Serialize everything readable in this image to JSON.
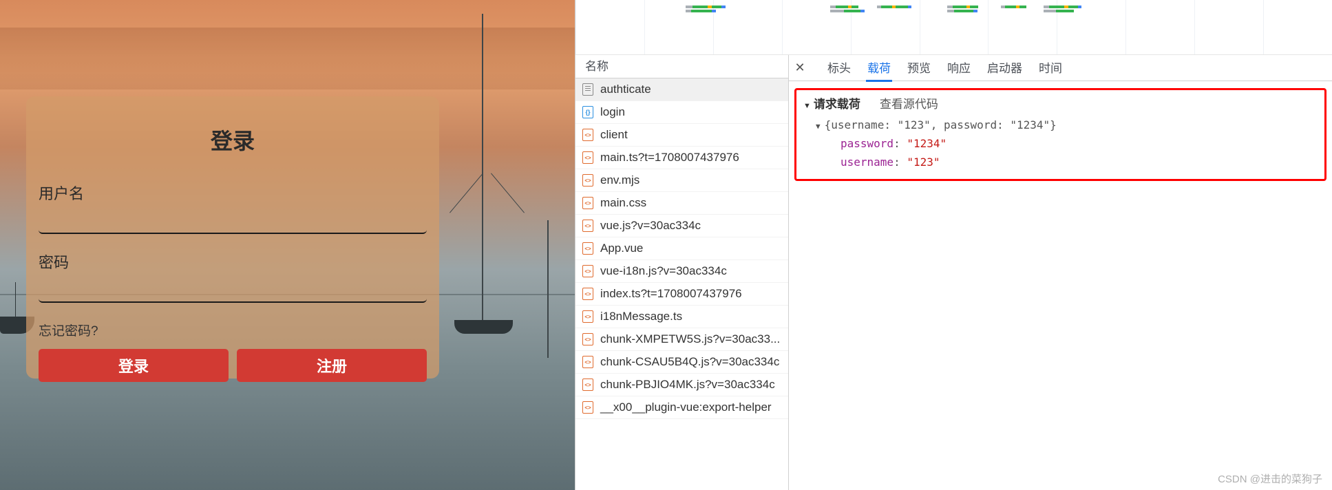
{
  "login": {
    "title": "登录",
    "username_label": "用户名",
    "password_label": "密码",
    "forgot": "忘记密码?",
    "login_btn": "登录",
    "register_btn": "注册"
  },
  "network": {
    "header": "名称",
    "items": [
      {
        "name": "authticate",
        "type": "doc",
        "selected": true
      },
      {
        "name": "login",
        "type": "json"
      },
      {
        "name": "client",
        "type": "js"
      },
      {
        "name": "main.ts?t=1708007437976",
        "type": "js"
      },
      {
        "name": "env.mjs",
        "type": "js"
      },
      {
        "name": "main.css",
        "type": "js"
      },
      {
        "name": "vue.js?v=30ac334c",
        "type": "js"
      },
      {
        "name": "App.vue",
        "type": "js"
      },
      {
        "name": "vue-i18n.js?v=30ac334c",
        "type": "js"
      },
      {
        "name": "index.ts?t=1708007437976",
        "type": "js"
      },
      {
        "name": "i18nMessage.ts",
        "type": "js"
      },
      {
        "name": "chunk-XMPETW5S.js?v=30ac33...",
        "type": "js"
      },
      {
        "name": "chunk-CSAU5B4Q.js?v=30ac334c",
        "type": "js"
      },
      {
        "name": "chunk-PBJIO4MK.js?v=30ac334c",
        "type": "js"
      },
      {
        "name": "__x00__plugin-vue:export-helper",
        "type": "js"
      }
    ]
  },
  "tabs": {
    "headers": "标头",
    "payload": "载荷",
    "preview": "预览",
    "response": "响应",
    "initiator": "启动器",
    "timing": "时间"
  },
  "payload": {
    "title": "请求载荷",
    "view_source": "查看源代码",
    "summary": "{username: \"123\", password: \"1234\"}",
    "rows": [
      {
        "k": "password",
        "v": "\"1234\""
      },
      {
        "k": "username",
        "v": "\"123\""
      }
    ]
  },
  "watermark": "CSDN @进击的菜狗子"
}
